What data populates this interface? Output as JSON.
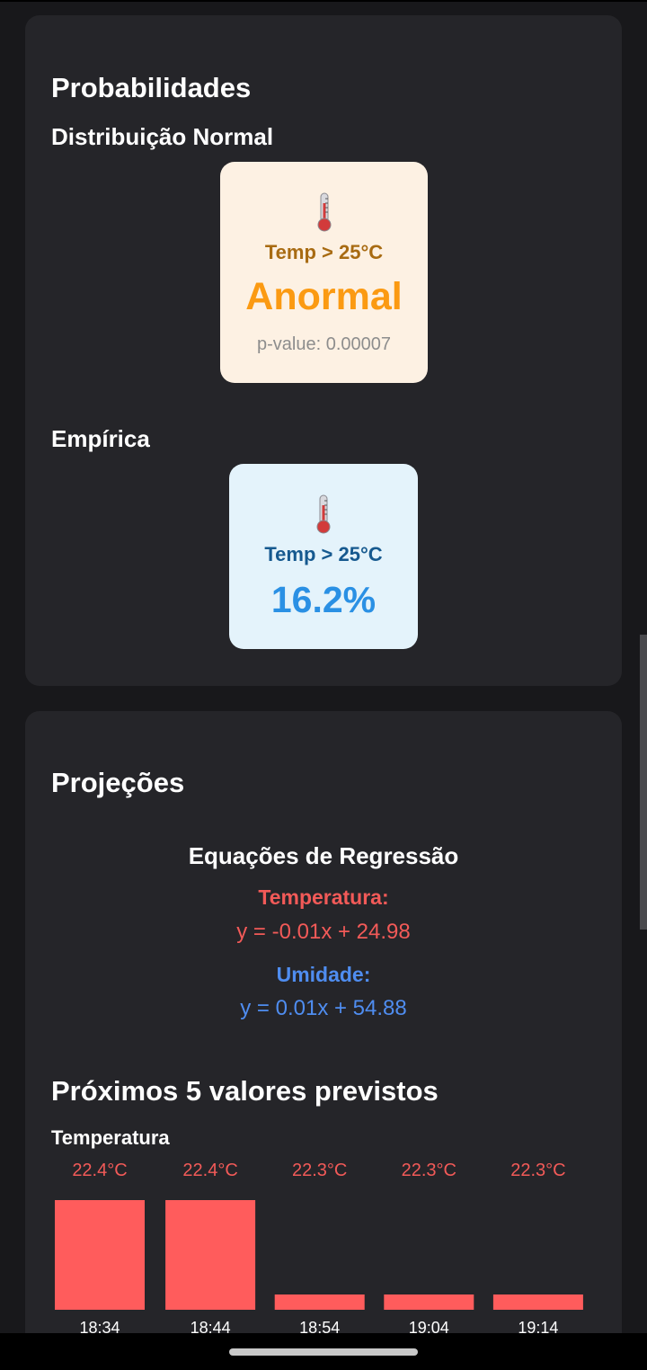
{
  "probabilities": {
    "title": "Probabilidades",
    "normal": {
      "subtitle": "Distribuição Normal",
      "icon": "thermometer-icon",
      "label": "Temp > 25°C",
      "value": "Anormal",
      "note": "p-value: 0.00007"
    },
    "empirical": {
      "subtitle": "Empírica",
      "icon": "thermometer-icon",
      "label": "Temp > 25°C",
      "value": "16.2%"
    }
  },
  "projections": {
    "title": "Projeções",
    "equations_title": "Equações de Regressão",
    "temperature_label": "Temperatura:",
    "temperature_equation": "y = -0.01x + 24.98",
    "humidity_label": "Umidade:",
    "humidity_equation": "y = 0.01x + 54.88",
    "forecast_title": "Próximos 5 valores previstos",
    "chart_label": "Temperatura"
  },
  "chart_data": {
    "type": "bar",
    "categories": [
      "18:34",
      "18:44",
      "18:54",
      "19:04",
      "19:14"
    ],
    "values": [
      22.4,
      22.4,
      22.3,
      22.3,
      22.3
    ],
    "data_labels": [
      "22.4°C",
      "22.4°C",
      "22.3°C",
      "22.3°C",
      "22.3°C"
    ],
    "title": "Temperatura",
    "xlabel": "",
    "ylabel": "",
    "ylim": [
      22.29,
      22.4
    ],
    "color": "#ff5c5c"
  },
  "colors": {
    "background": "#18181b",
    "card": "#252529",
    "normal_box": "#fdf1e3",
    "normal_accent": "#fb9a12",
    "empirical_box": "#e4f3fb",
    "empirical_accent": "#2a90e4",
    "temperature": "#f25a58",
    "humidity": "#4f8df0"
  }
}
